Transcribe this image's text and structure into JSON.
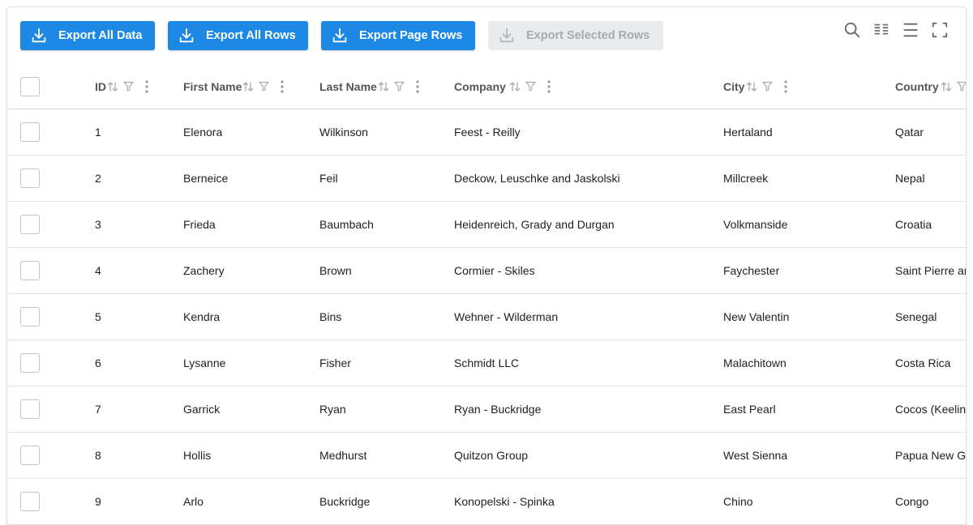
{
  "toolbar": {
    "buttons": [
      {
        "label": "Export All Data",
        "icon": "download-icon",
        "enabled": true
      },
      {
        "label": "Export All Rows",
        "icon": "download-icon",
        "enabled": true
      },
      {
        "label": "Export Page Rows",
        "icon": "download-icon",
        "enabled": true
      },
      {
        "label": "Export Selected Rows",
        "icon": "download-icon",
        "enabled": false
      }
    ],
    "icons": [
      "search-icon",
      "column-visibility-icon",
      "density-icon",
      "fullscreen-icon"
    ]
  },
  "colors": {
    "primary": "#1e88e5",
    "disabled_bg": "#e9ebee",
    "disabled_text": "#a6a9ad",
    "header_text": "#555555",
    "icon_gray": "#9aa0a6"
  },
  "table": {
    "columns": [
      {
        "key": "id",
        "label": "ID"
      },
      {
        "key": "first",
        "label": "First Name"
      },
      {
        "key": "last",
        "label": "Last Name"
      },
      {
        "key": "company",
        "label": "Company"
      },
      {
        "key": "city",
        "label": "City"
      },
      {
        "key": "country",
        "label": "Country"
      }
    ],
    "rows": [
      {
        "id": "1",
        "first": "Elenora",
        "last": "Wilkinson",
        "company": "Feest - Reilly",
        "city": "Hertaland",
        "country": "Qatar"
      },
      {
        "id": "2",
        "first": "Berneice",
        "last": "Feil",
        "company": "Deckow, Leuschke and Jaskolski",
        "city": "Millcreek",
        "country": "Nepal"
      },
      {
        "id": "3",
        "first": "Frieda",
        "last": "Baumbach",
        "company": "Heidenreich, Grady and Durgan",
        "city": "Volkmanside",
        "country": "Croatia"
      },
      {
        "id": "4",
        "first": "Zachery",
        "last": "Brown",
        "company": "Cormier - Skiles",
        "city": "Faychester",
        "country": "Saint Pierre ar"
      },
      {
        "id": "5",
        "first": "Kendra",
        "last": "Bins",
        "company": "Wehner - Wilderman",
        "city": "New Valentin",
        "country": "Senegal"
      },
      {
        "id": "6",
        "first": "Lysanne",
        "last": "Fisher",
        "company": "Schmidt LLC",
        "city": "Malachitown",
        "country": "Costa Rica"
      },
      {
        "id": "7",
        "first": "Garrick",
        "last": "Ryan",
        "company": "Ryan - Buckridge",
        "city": "East Pearl",
        "country": "Cocos (Keeling"
      },
      {
        "id": "8",
        "first": "Hollis",
        "last": "Medhurst",
        "company": "Quitzon Group",
        "city": "West Sienna",
        "country": "Papua New Gu"
      },
      {
        "id": "9",
        "first": "Arlo",
        "last": "Buckridge",
        "company": "Konopelski - Spinka",
        "city": "Chino",
        "country": "Congo"
      }
    ]
  }
}
